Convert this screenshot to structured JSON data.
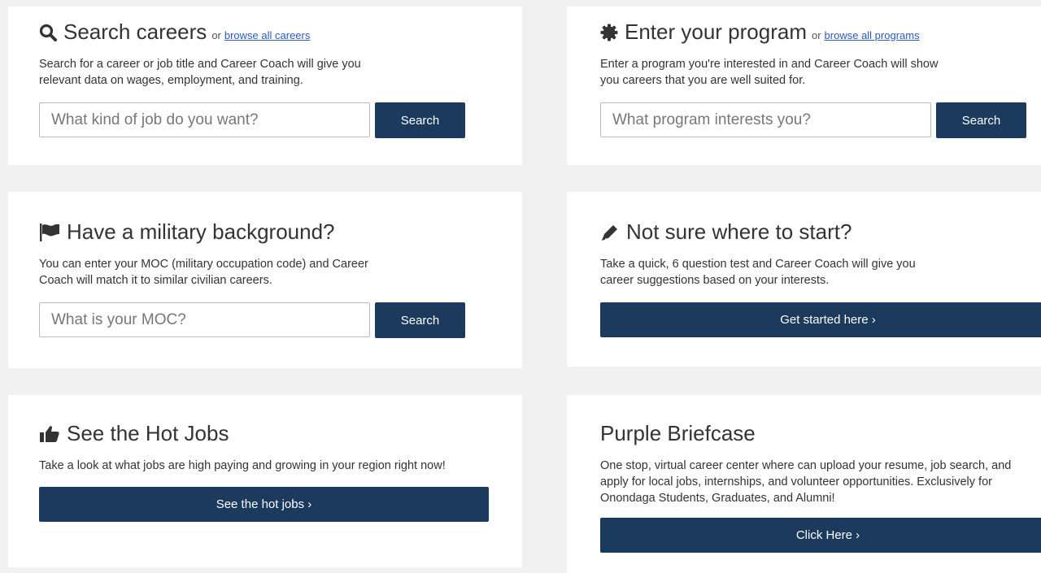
{
  "careers": {
    "title": "Search careers",
    "or": "or",
    "browse": "browse all careers",
    "desc1": "Search for a career or job title and Career Coach will give you",
    "desc2": "relevant data on wages, employment, and training.",
    "placeholder": "What kind of job do you want?",
    "button": "Search"
  },
  "program": {
    "title": "Enter your program",
    "or": "or",
    "browse": "browse all programs",
    "desc1": "Enter a program you're interested in and Career Coach will show",
    "desc2": "you careers that you are well suited for.",
    "placeholder": "What program interests you?",
    "button": "Search"
  },
  "military": {
    "title": "Have a military background?",
    "desc1": "You can enter your MOC (military occupation code) and Career",
    "desc2": "Coach will match it to similar civilian careers.",
    "placeholder": "What is your MOC?",
    "button": "Search"
  },
  "start": {
    "title": "Not sure where to start?",
    "desc1": "Take a quick, 6 question test and Career Coach will give you",
    "desc2": "career suggestions based on your interests.",
    "button": "Get started here ›"
  },
  "hotjobs": {
    "title": "See the Hot Jobs",
    "desc": "Take a look at what jobs are high paying and growing in your region right now!",
    "button": "See the hot jobs ›"
  },
  "briefcase": {
    "title": "Purple Briefcase",
    "desc": "One stop, virtual career center where can upload your resume, job search, and apply for local jobs, internships, and volunteer opportunities. Exclusively for Onondaga Students, Graduates, and Alumni!",
    "button": "Click Here ›"
  },
  "colors": {
    "button_bg": "#1b3a5e",
    "link": "#2a5bbf",
    "page_bg": "#f1f1f1"
  }
}
